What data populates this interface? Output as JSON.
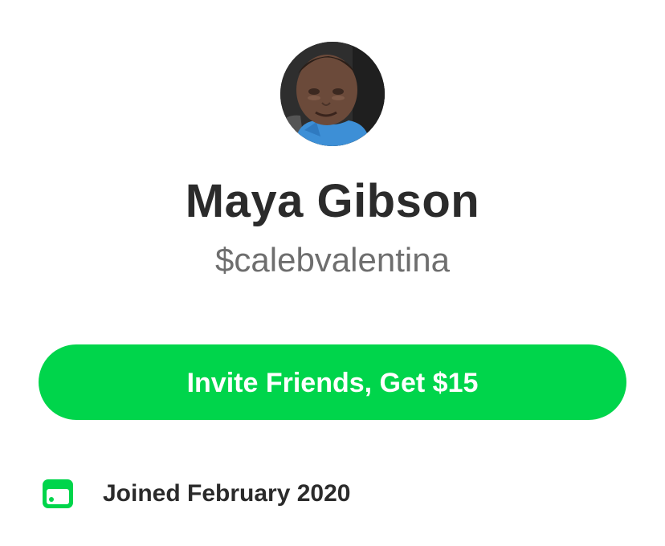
{
  "profile": {
    "avatar_icon": "profile-photo",
    "name": "Maya Gibson",
    "handle": "$calebvalentina"
  },
  "invite_button": {
    "label": "Invite Friends, Get $15",
    "color": "#00d54b"
  },
  "joined": {
    "icon": "calendar-icon",
    "text": "Joined February 2020",
    "icon_color": "#00d54b"
  }
}
